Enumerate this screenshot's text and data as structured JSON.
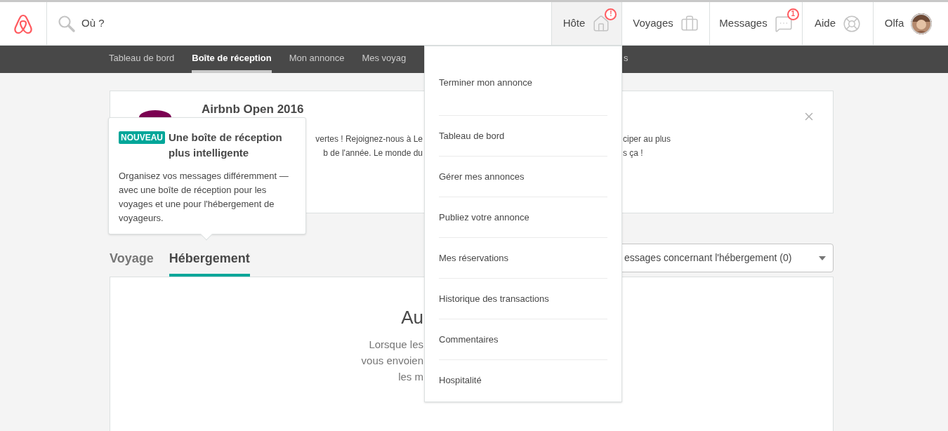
{
  "header": {
    "search": {
      "placeholder": "Où ?"
    },
    "nav": [
      {
        "label": "Hôte",
        "kind": "house",
        "badge": "!",
        "selected": true
      },
      {
        "label": "Voyages",
        "kind": "suitcase",
        "selected": false
      },
      {
        "label": "Messages",
        "kind": "chat",
        "badge": "1",
        "selected": false
      },
      {
        "label": "Aide",
        "kind": "lifebuoy",
        "selected": false
      },
      {
        "label": "Olfa",
        "kind": "avatar",
        "selected": false
      }
    ]
  },
  "subnav": {
    "before_menu": [
      {
        "label": "Tableau de bord",
        "selected": false
      },
      {
        "label": "Boîte de réception",
        "selected": true
      },
      {
        "label": "Mon annonce",
        "selected": false
      },
      {
        "label": "Mes voyag",
        "selected": false
      }
    ],
    "after_menu": [
      {
        "label": "s",
        "selected": false
      }
    ]
  },
  "announcement": {
    "title": "Airbnb Open 2016",
    "lines": [
      {
        "left": "vertes ! Rejoignez-nous à Le",
        "right": "ciper au plus"
      },
      {
        "left": "b de l'année. Le monde du",
        "right": "s ça !"
      }
    ]
  },
  "inbox_tabs": [
    {
      "label": "Voyage",
      "selected": false
    },
    {
      "label": "Hébergement",
      "selected": true
    }
  ],
  "filter_select": {
    "value": "essages concernant l'hébergement (0)"
  },
  "empty_state": {
    "title": "Au",
    "lines": [
      "Lorsque les",
      "vous envoien",
      "les m"
    ]
  },
  "tooltip": {
    "badge": "NOUVEAU",
    "title": "Une boîte de réception plus intelligente",
    "body": "Organisez vos messages différemment — avec une boîte de réception pour les voyages et une pour l'hébergement de voyageurs."
  },
  "host_menu": {
    "items": [
      "Terminer mon annonce",
      "Tableau de bord",
      "Gérer mes annonces",
      "Publiez votre annonce",
      "Mes réservations",
      "Historique des transactions",
      "Commentaires",
      "Hospitalité"
    ]
  }
}
